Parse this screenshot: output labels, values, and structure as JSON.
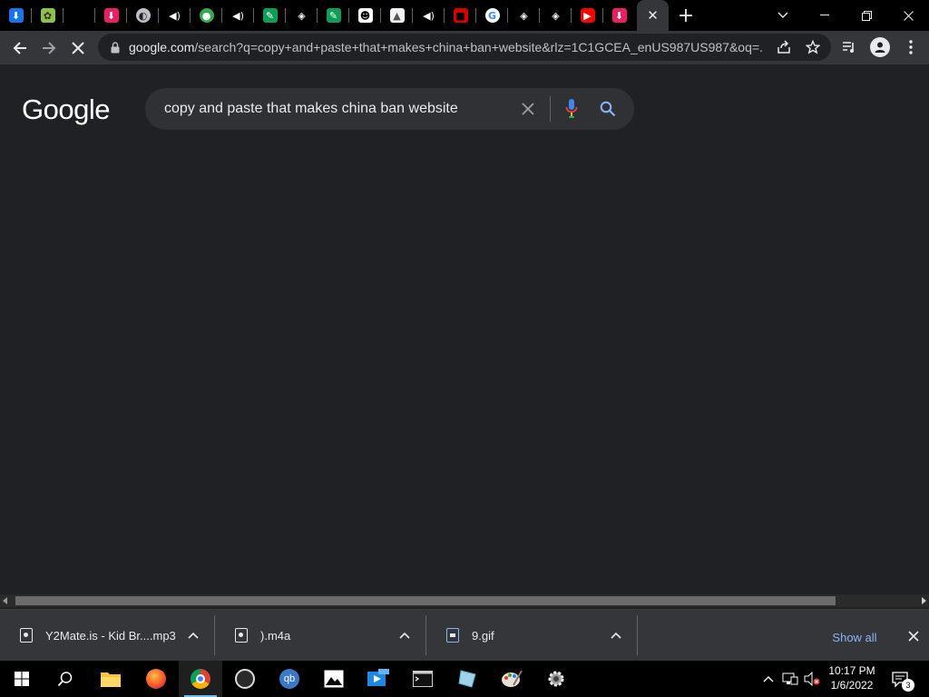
{
  "browser": {
    "tabs": [
      {
        "icon": "download-arrow-icon",
        "color": "#1a73e8"
      },
      {
        "icon": "gear-puzzle-icon",
        "color": "#8bc34a"
      },
      {
        "icon": "blank-tab-icon",
        "color": "#000000"
      },
      {
        "icon": "download-red-icon",
        "color": "#e91e63"
      },
      {
        "icon": "globe-icon",
        "color": "#bdc1c6"
      },
      {
        "icon": "speaker-icon",
        "color": "#e8eaed"
      },
      {
        "icon": "location-pin-icon",
        "color": "#34a853"
      },
      {
        "icon": "speaker-icon",
        "color": "#e8eaed"
      },
      {
        "icon": "green-app-icon",
        "color": "#0f9d58"
      },
      {
        "icon": "layers-icon",
        "color": "#e8eaed"
      },
      {
        "icon": "green-app-icon",
        "color": "#0f9d58"
      },
      {
        "icon": "cat-face-icon",
        "color": "#ffffff"
      },
      {
        "icon": "document-image-icon",
        "color": "#f1f3f4"
      },
      {
        "icon": "speaker-icon",
        "color": "#e8eaed"
      },
      {
        "icon": "red-square-icon",
        "color": "#d50000"
      },
      {
        "icon": "google-g-icon",
        "color": "#ffffff"
      },
      {
        "icon": "layers-icon",
        "color": "#e8eaed"
      },
      {
        "icon": "layers-icon",
        "color": "#e8eaed"
      },
      {
        "icon": "youtube-icon",
        "color": "#ff0000"
      },
      {
        "icon": "download-red-icon",
        "color": "#e91e63"
      }
    ],
    "active_tab_close": "✕",
    "new_tab": "+",
    "url_host": "google.com",
    "url_rest": "/search?q=copy+and+paste+that+makes+china+ban+website&rlz=1C1GCEA_enUS987US987&oq=..."
  },
  "page": {
    "logo": "Google",
    "search_query": "copy and paste that makes china ban website"
  },
  "downloads": {
    "items": [
      {
        "name": "Y2Mate.is - Kid Br....mp3",
        "type": "audio"
      },
      {
        "name": ").m4a",
        "type": "audio"
      },
      {
        "name": "9.gif",
        "type": "image"
      }
    ],
    "show_all": "Show all"
  },
  "taskbar": {
    "apps": [
      "start-windows-icon",
      "search-icon",
      "file-explorer-icon",
      "firefox-icon",
      "chrome-icon",
      "obs-icon",
      "qbittorrent-icon",
      "photos-icon",
      "video-editor-icon",
      "terminal-icon",
      "notepad-icon",
      "paint-icon",
      "settings-gear-icon"
    ],
    "qbittorrent_label": "qb",
    "time": "10:17 PM",
    "date": "1/6/2022",
    "notification_count": "3"
  },
  "colors": {
    "page_bg": "#202124",
    "toolbar_bg": "#35363a",
    "accent_blue": "#8ab4f8"
  }
}
